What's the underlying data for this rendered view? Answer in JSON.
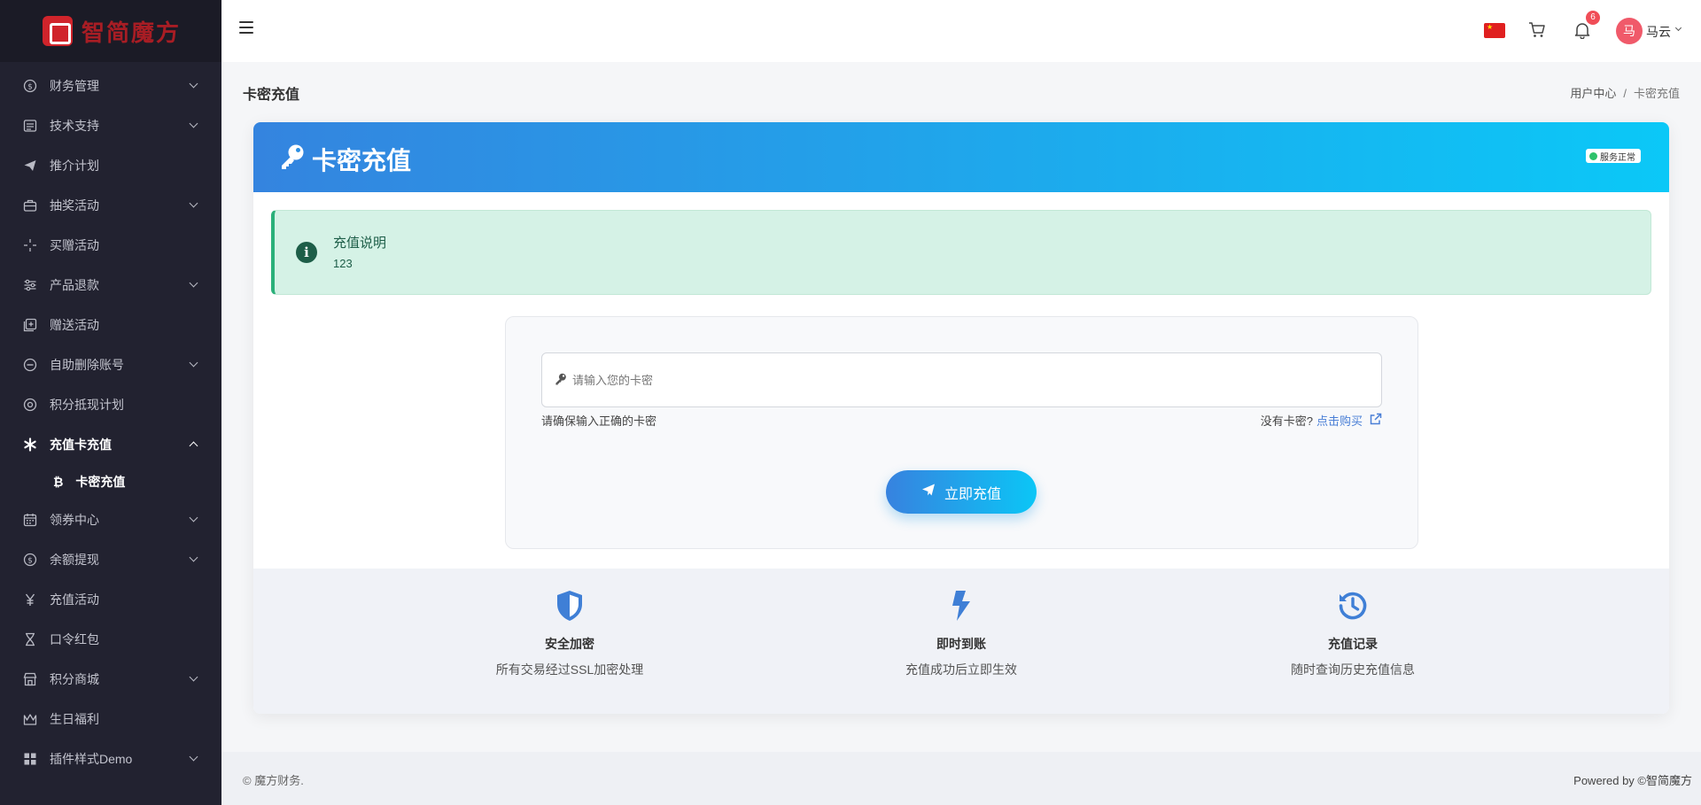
{
  "brand": {
    "logo_text": "智简魔方"
  },
  "sidebar": {
    "items": [
      {
        "label": "财务管理",
        "icon": "dollar-circle-icon",
        "expandable": true
      },
      {
        "label": "技术支持",
        "icon": "document-icon",
        "expandable": true
      },
      {
        "label": "推介计划",
        "icon": "send-icon",
        "expandable": false
      },
      {
        "label": "抽奖活动",
        "icon": "briefcase-icon",
        "expandable": true
      },
      {
        "label": "买赠活动",
        "icon": "sparkle-icon",
        "expandable": false
      },
      {
        "label": "产品退款",
        "icon": "sliders-icon",
        "expandable": true
      },
      {
        "label": "赠送活动",
        "icon": "gift-box-icon",
        "expandable": false
      },
      {
        "label": "自助删除账号",
        "icon": "minus-circle-icon",
        "expandable": true
      },
      {
        "label": "积分抵现计划",
        "icon": "target-icon",
        "expandable": false
      },
      {
        "label": "充值卡充值",
        "icon": "asterisk-icon",
        "expandable": true,
        "open": true
      },
      {
        "label": "领券中心",
        "icon": "calendar-icon",
        "expandable": true
      },
      {
        "label": "余额提现",
        "icon": "dollar-circle-icon",
        "expandable": true
      },
      {
        "label": "充值活动",
        "icon": "yen-icon",
        "expandable": false
      },
      {
        "label": "口令红包",
        "icon": "hourglass-icon",
        "expandable": false
      },
      {
        "label": "积分商城",
        "icon": "store-icon",
        "expandable": true
      },
      {
        "label": "生日福利",
        "icon": "crown-icon",
        "expandable": false
      },
      {
        "label": "插件样式Demo",
        "icon": "grid-icon",
        "expandable": true
      }
    ],
    "submenu": {
      "label": "卡密充值",
      "icon": "bitcoin-icon",
      "glyph": "₿"
    }
  },
  "topbar": {
    "notification_count": "6",
    "avatar_initial": "马",
    "username": "马云"
  },
  "page": {
    "title": "卡密充值",
    "breadcrumb": {
      "home": "用户中心",
      "separator": "/",
      "current": "卡密充值"
    }
  },
  "card": {
    "title": "卡密充值",
    "status": "服务正常",
    "notice": {
      "title": "充值说明",
      "text": "123"
    },
    "form": {
      "placeholder": "请输入您的卡密",
      "value": "",
      "hint": "请确保输入正确的卡密",
      "no_card_text": "没有卡密?",
      "buy_link": "点击购买",
      "submit_label": "立即充值"
    },
    "features": [
      {
        "icon": "shield-icon",
        "title": "安全加密",
        "desc": "所有交易经过SSL加密处理"
      },
      {
        "icon": "lightning-icon",
        "title": "即时到账",
        "desc": "充值成功后立即生效"
      },
      {
        "icon": "history-icon",
        "title": "充值记录",
        "desc": "随时查询历史充值信息"
      }
    ]
  },
  "footer": {
    "copyright": "© 魔方财务.",
    "powered": "Powered by ©智简魔方"
  },
  "colors": {
    "sidebar_bg": "#222230",
    "accent": "#3484df",
    "accent_end": "#0bc8f7",
    "notice_bg": "#d5f2e6",
    "badge": "#f04d57"
  }
}
